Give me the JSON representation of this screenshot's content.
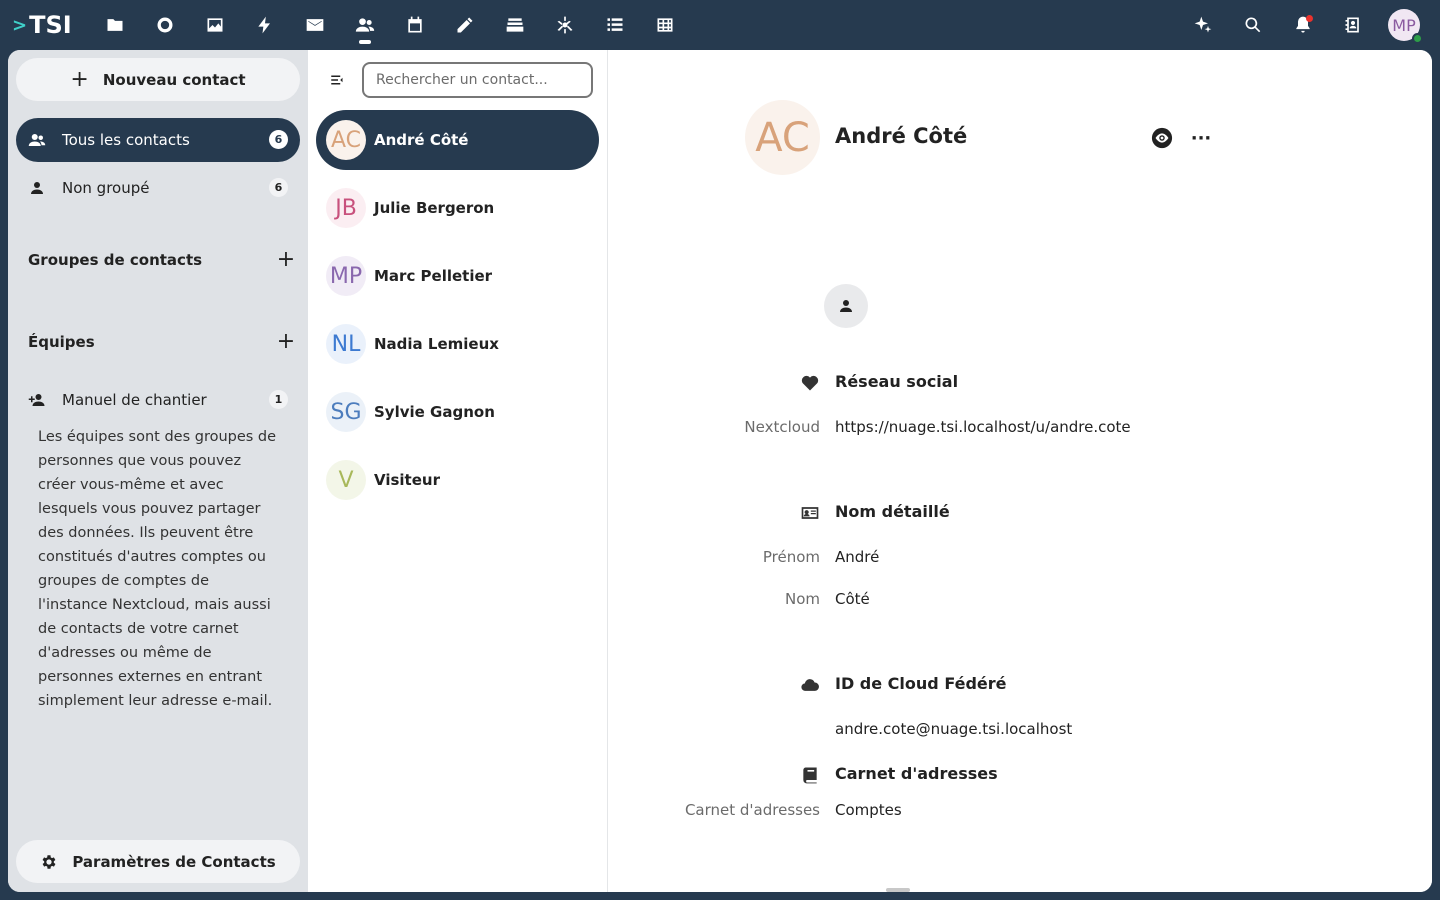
{
  "brand": {
    "logo_text": "TSI",
    "chevron": ">"
  },
  "topbar": {
    "apps": [
      "files-icon",
      "circle-icon",
      "photos-icon",
      "activity-icon",
      "mail-icon",
      "contacts-icon",
      "calendar-icon",
      "notes-icon",
      "deck-icon",
      "assistant-icon",
      "tasks-icon",
      "tables-icon"
    ],
    "active_app": "contacts-icon",
    "user_initials": "MP"
  },
  "nav": {
    "new_contact_label": "Nouveau contact",
    "items": [
      {
        "label": "Tous les contacts",
        "count": "6"
      },
      {
        "label": "Non groupé",
        "count": "6"
      }
    ],
    "groups_title": "Groupes de contacts",
    "teams_title": "Équipes",
    "team_item": {
      "label": "Manuel de chantier",
      "count": "1"
    },
    "teams_description": "Les équipes sont des groupes de personnes que vous pouvez créer vous-même et avec lesquels vous pouvez partager des données. Ils peuvent être constitués d'autres comptes ou groupes de comptes de l'instance Nextcloud, mais aussi de contacts de votre carnet d'adresses ou même de personnes externes en entrant simplement leur adresse e-mail.",
    "settings_label": "Paramètres de Contacts"
  },
  "list": {
    "search_placeholder": "Rechercher un contact...",
    "contacts": [
      {
        "initials": "AC",
        "name": "André Côté",
        "bg": "#faf2ec",
        "fg": "#d8a27a"
      },
      {
        "initials": "JB",
        "name": "Julie Bergeron",
        "bg": "#fbeef2",
        "fg": "#c8517d"
      },
      {
        "initials": "MP",
        "name": "Marc Pelletier",
        "bg": "#f1ecf6",
        "fg": "#8a68ae"
      },
      {
        "initials": "NL",
        "name": "Nadia Lemieux",
        "bg": "#eaf1fb",
        "fg": "#3d7ad1"
      },
      {
        "initials": "SG",
        "name": "Sylvie Gagnon",
        "bg": "#ebf1f8",
        "fg": "#4d7dbd"
      },
      {
        "initials": "V",
        "name": "Visiteur",
        "bg": "#f3f6e8",
        "fg": "#a8b85a"
      }
    ]
  },
  "details": {
    "initials": "AC",
    "name": "André Côté",
    "social": {
      "title": "Réseau social",
      "label": "Nextcloud",
      "value": "https://nuage.tsi.localhost/u/andre.cote"
    },
    "detailed_name": {
      "title": "Nom détaillé",
      "first_label": "Prénom",
      "first_value": "André",
      "last_label": "Nom",
      "last_value": "Côté"
    },
    "cloud_id": {
      "title": "ID de Cloud Fédéré",
      "value": "andre.cote@nuage.tsi.localhost"
    },
    "addressbook": {
      "title": "Carnet d'adresses",
      "label": "Carnet d'adresses",
      "value": "Comptes"
    }
  }
}
